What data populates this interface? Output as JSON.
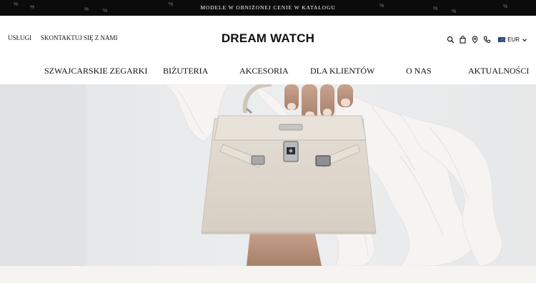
{
  "promo": {
    "text": "MODELE W OBNIŻONEJ CENIE W KATALOGU",
    "pattern_glyph": "%"
  },
  "header": {
    "links": [
      "USŁUGI",
      "SKONTAKTUJ SIĘ Z NAMI"
    ],
    "logo": "DREAM WATCH",
    "icons": [
      "search-icon",
      "bag-icon",
      "location-pin-icon",
      "phone-icon"
    ],
    "currency": "EUR"
  },
  "nav": {
    "items": [
      "SZWAJCARSKIE ZEGARKI",
      "BIŻUTERIA",
      "AKCESORIA",
      "DLA KLIENTÓW",
      "O NAS",
      "AKTUALNOŚCI"
    ]
  },
  "colors": {
    "promo_bg": "#0b0b0b",
    "bag": "#ddd6cc",
    "bottom_strip": "#f6f4f1"
  }
}
